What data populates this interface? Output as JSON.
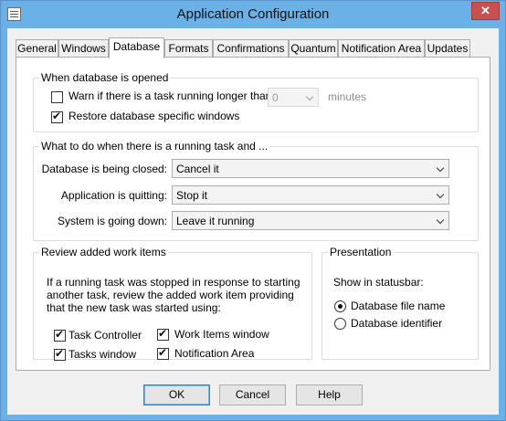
{
  "window": {
    "title": "Application Configuration",
    "close_glyph": "✕"
  },
  "tabs": [
    {
      "label": "General",
      "active": false
    },
    {
      "label": "Windows",
      "active": false
    },
    {
      "label": "Database",
      "active": true
    },
    {
      "label": "Formats",
      "active": false
    },
    {
      "label": "Confirmations",
      "active": false
    },
    {
      "label": "Quantum",
      "active": false
    },
    {
      "label": "Notification Area",
      "active": false
    },
    {
      "label": "Updates",
      "active": false
    }
  ],
  "when_opened": {
    "title": "When database is opened",
    "warn_label": "Warn if there is a task running longer than:",
    "warn_checked": false,
    "warn_value": "0",
    "warn_unit": "minutes",
    "restore_label": "Restore database specific windows",
    "restore_checked": true
  },
  "running_task": {
    "title": "What to do when there is a running task and ...",
    "closing_label": "Database is being closed:",
    "closing_value": "Cancel it",
    "quitting_label": "Application is quitting:",
    "quitting_value": "Stop it",
    "shutdown_label": "System is going down:",
    "shutdown_value": "Leave it running"
  },
  "review": {
    "title": "Review added work items",
    "description": "If a running task was stopped in response to starting another task, review the added work item providing that the new task was started using:",
    "task_controller": {
      "label": "Task Controller",
      "checked": true
    },
    "work_items_window": {
      "label": "Work Items window",
      "checked": true
    },
    "tasks_window": {
      "label": "Tasks window",
      "checked": true
    },
    "notification_area": {
      "label": "Notification Area",
      "checked": true
    }
  },
  "presentation": {
    "title": "Presentation",
    "statusbar_label": "Show in statusbar:",
    "options": [
      {
        "label": "Database file name",
        "selected": true
      },
      {
        "label": "Database identifier",
        "selected": false
      }
    ]
  },
  "buttons": {
    "ok": "OK",
    "cancel": "Cancel",
    "help": "Help"
  },
  "colors": {
    "frame": "#6cb0e8",
    "close_button": "#c75050",
    "client": "#f0f0f0",
    "panel": "#ffffff"
  }
}
